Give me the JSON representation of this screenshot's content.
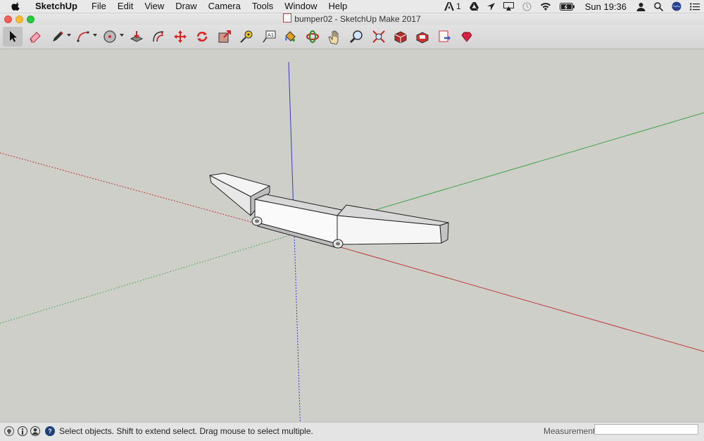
{
  "menubar": {
    "app_name": "SketchUp",
    "items": [
      "File",
      "Edit",
      "View",
      "Draw",
      "Camera",
      "Tools",
      "Window",
      "Help"
    ],
    "adobe_count": "1",
    "clock": "Sun 19:36"
  },
  "window": {
    "title": "bumper02 - SketchUp Make 2017"
  },
  "toolbar": {
    "tools": [
      {
        "name": "select-tool",
        "icon": "arrow-icon"
      },
      {
        "name": "eraser-tool",
        "icon": "eraser-icon"
      },
      {
        "name": "line-tool",
        "icon": "pencil-icon"
      },
      {
        "name": "arc-tool",
        "icon": "arc-icon"
      },
      {
        "name": "shapes-tool",
        "icon": "circle-icon"
      },
      {
        "name": "push-pull-tool",
        "icon": "push-pull-icon"
      },
      {
        "name": "offset-tool",
        "icon": "offset-icon"
      },
      {
        "name": "move-tool",
        "icon": "move-icon"
      },
      {
        "name": "rotate-tool",
        "icon": "rotate-icon"
      },
      {
        "name": "scale-tool",
        "icon": "scale-icon"
      },
      {
        "name": "tape-measure-tool",
        "icon": "tape-icon"
      },
      {
        "name": "text-tool",
        "icon": "text-icon"
      },
      {
        "name": "paint-bucket-tool",
        "icon": "bucket-icon"
      },
      {
        "name": "orbit-tool",
        "icon": "orbit-icon"
      },
      {
        "name": "pan-tool",
        "icon": "hand-icon"
      },
      {
        "name": "zoom-tool",
        "icon": "magnifier-icon"
      },
      {
        "name": "zoom-extents-tool",
        "icon": "zoom-extents-icon"
      },
      {
        "name": "3d-warehouse-button",
        "icon": "warehouse-icon"
      },
      {
        "name": "extension-warehouse-button",
        "icon": "extension-icon"
      },
      {
        "name": "send-to-layout-button",
        "icon": "layout-icon"
      },
      {
        "name": "extension-manager-button",
        "icon": "ruby-icon"
      }
    ]
  },
  "statusbar": {
    "message": "Select objects. Shift to extend select. Drag mouse to select multiple.",
    "measurements_label": "Measurements",
    "measurements_value": ""
  },
  "colors": {
    "viewport_bg": "#cfcfca",
    "red_axis": "#c0393b",
    "green_axis": "#3fa34a",
    "blue_axis": "#3a3aca",
    "face_light": "#ffffff",
    "face_shade": "#bdbdbd"
  }
}
